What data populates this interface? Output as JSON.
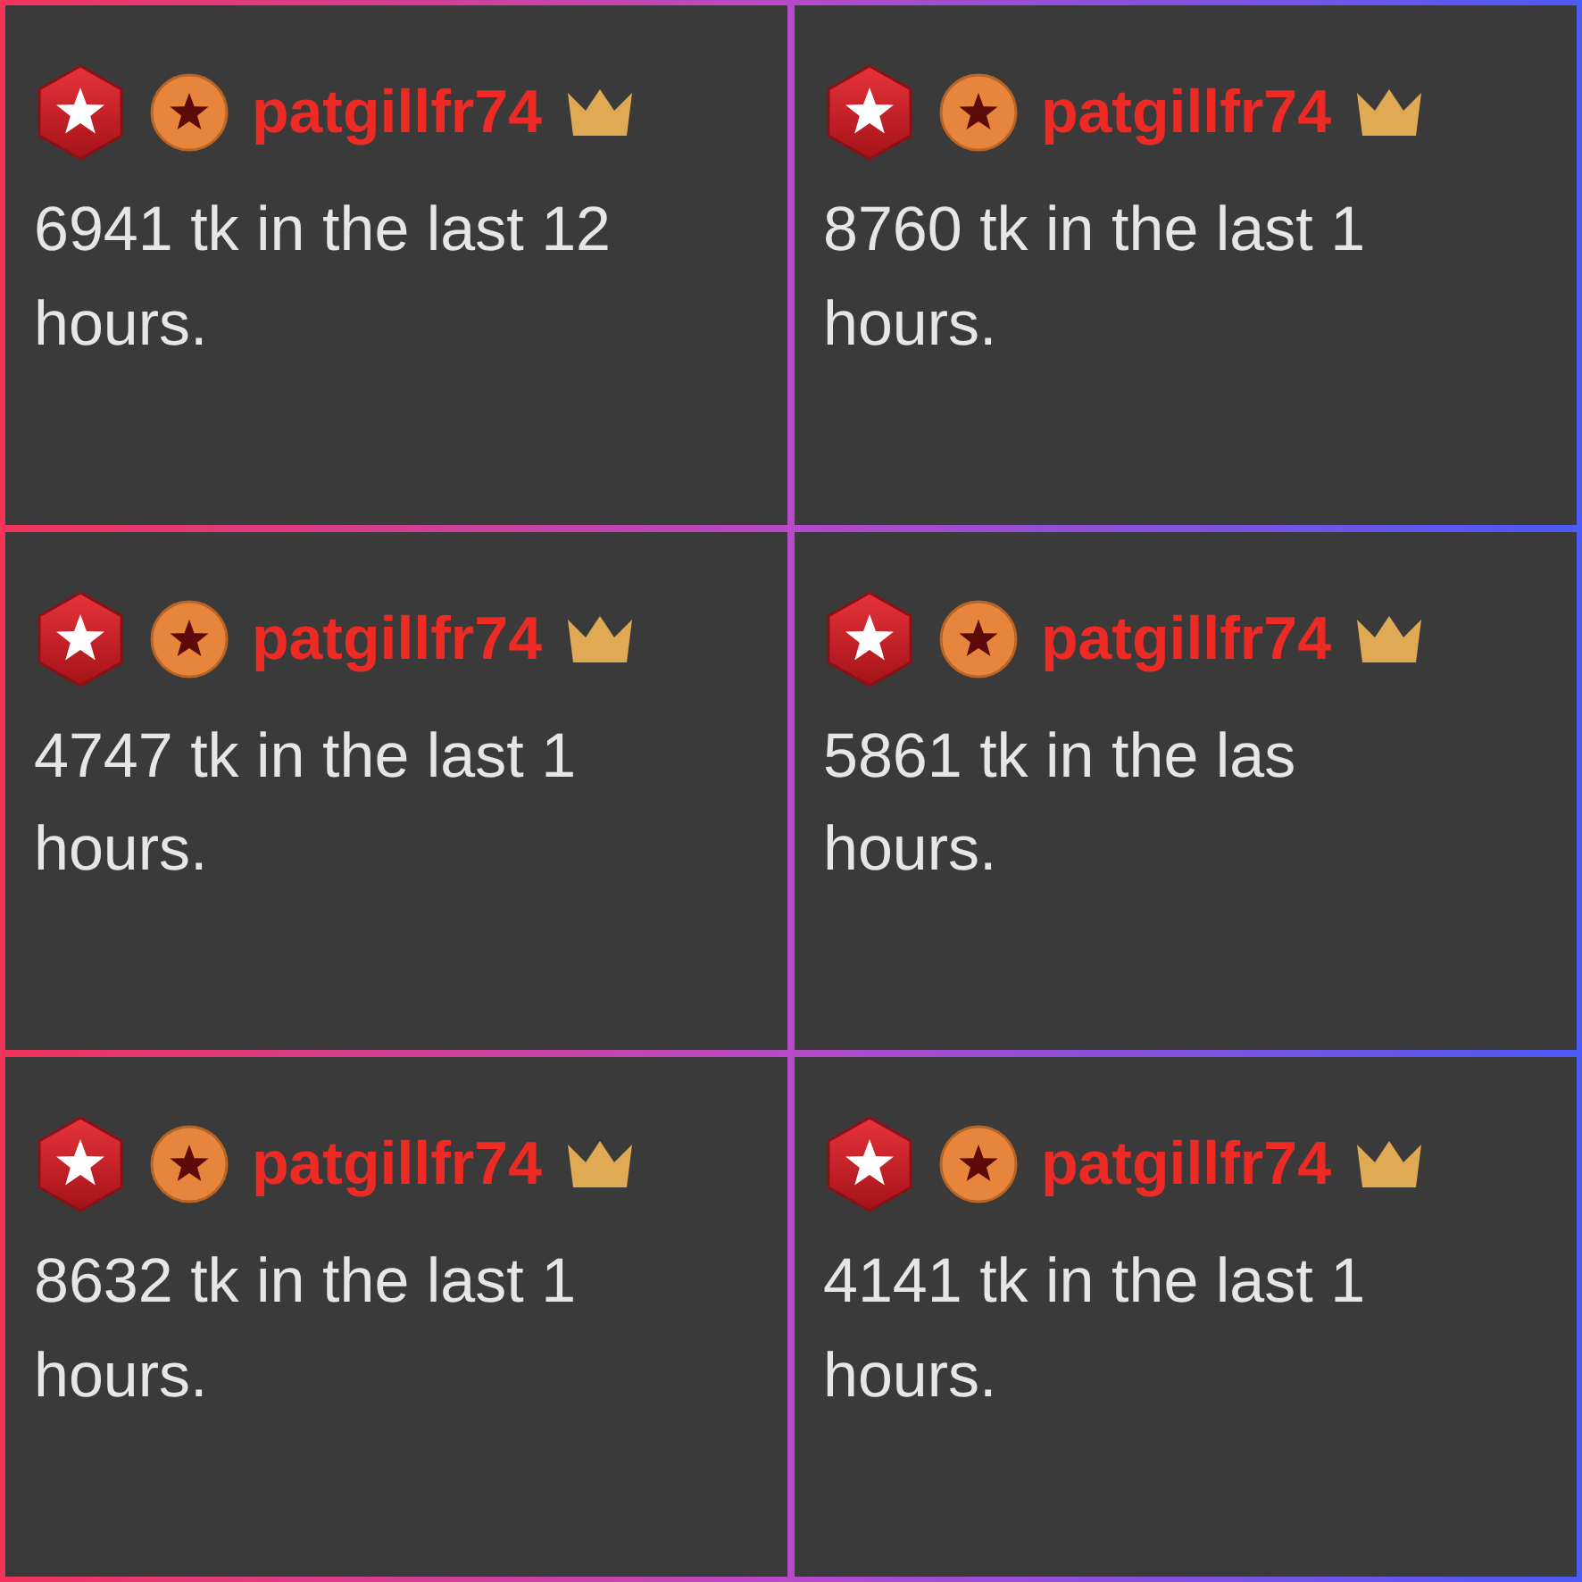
{
  "tiles": [
    {
      "username": "patgillfr74",
      "lines": [
        "6941 tk in the last 12",
        "hours."
      ]
    },
    {
      "username": "patgillfr74",
      "lines": [
        "8760 tk in the last 1",
        "hours."
      ]
    },
    {
      "username": "patgillfr74",
      "lines": [
        "4747 tk in the last 1",
        "hours."
      ]
    },
    {
      "username": "patgillfr74",
      "lines": [
        "5861 tk in the las",
        "hours."
      ]
    },
    {
      "username": "patgillfr74",
      "lines": [
        "8632 tk in the last 1",
        "hours."
      ]
    },
    {
      "username": "patgillfr74",
      "lines": [
        "4141 tk in the last 1",
        "hours."
      ]
    }
  ]
}
